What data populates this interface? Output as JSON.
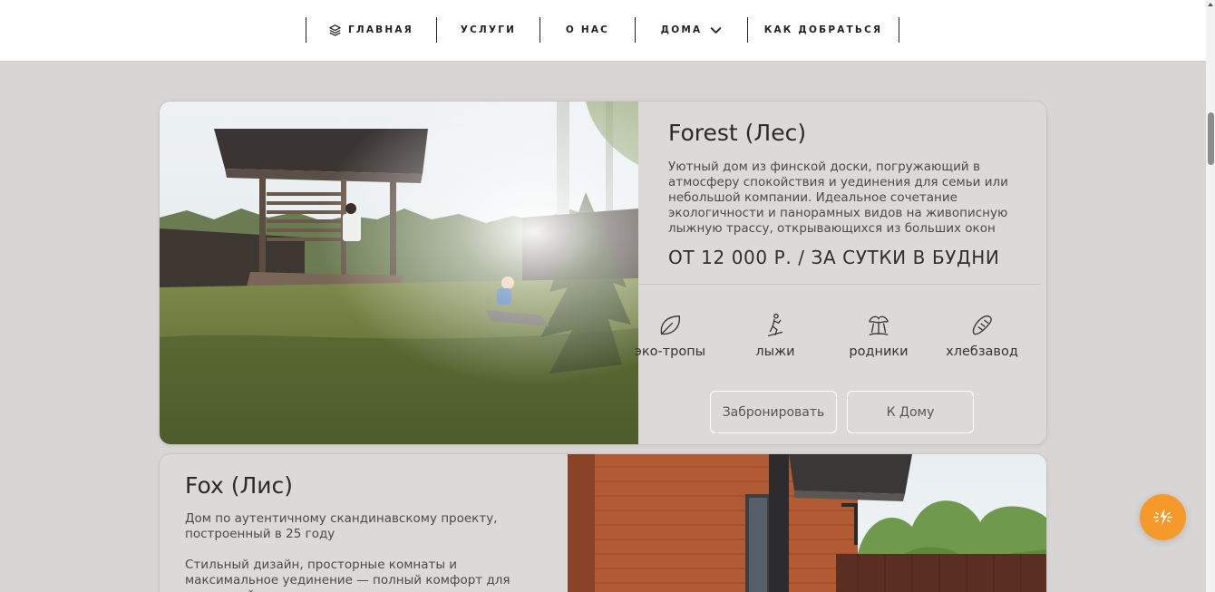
{
  "nav": {
    "items": [
      {
        "label": "ГЛАВНАЯ",
        "icon": "layers-icon"
      },
      {
        "label": "УСЛУГИ"
      },
      {
        "label": "О НАС"
      },
      {
        "label": "ДОМА",
        "icon": "chevron-down-icon"
      },
      {
        "label": "КАК ДОБРАТЬСЯ"
      }
    ]
  },
  "houses": [
    {
      "title": "Forest (Лес)",
      "description": "Уютный дом из финской доски, погружающий в атмосферу спокойствия и уединения для семьи или небольшой компании. Идеальное сочетание экологичности и панорамных видов на живописную лыжную трассу, открывающихся из больших окон",
      "price": "ОТ 12 000 Р. / ЗА СУТКИ В БУДНИ",
      "features": [
        {
          "label": "эко-тропы",
          "icon": "leaf-icon"
        },
        {
          "label": "лыжи",
          "icon": "skier-icon"
        },
        {
          "label": "родники",
          "icon": "spring-icon"
        },
        {
          "label": "хлебзавод",
          "icon": "bread-icon"
        }
      ],
      "book_label": "Забронировать",
      "home_label": "К Дому"
    },
    {
      "title": "Fox (Лис)",
      "description_1": "Дом по аутентичному скандинавскому проекту, построенный в 25 году",
      "description_2": "Стильный дизайн, просторные комнаты и максимальное уединение — полный комфорт для ценителей"
    }
  ],
  "colors": {
    "background": "#d8d6d4",
    "card": "#dcdad8",
    "accent_fab": "#f59a2a",
    "text": "#2b2b2b"
  },
  "fab": {
    "icon": "sparkle-icon"
  }
}
